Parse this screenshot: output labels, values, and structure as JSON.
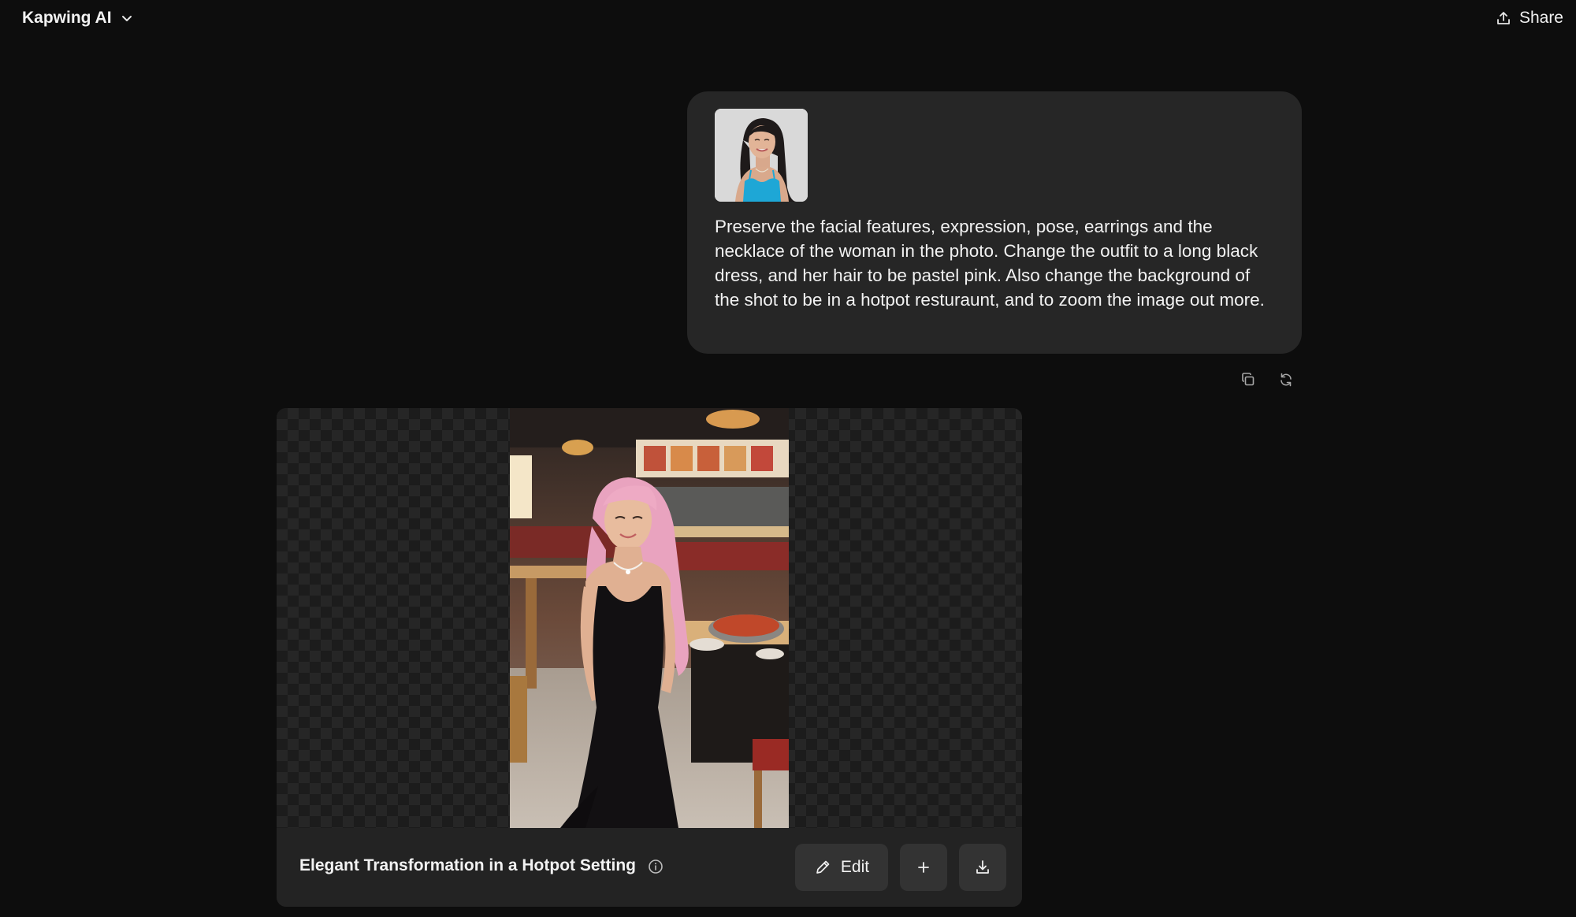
{
  "app": {
    "title": "Kapwing AI",
    "share_label": "Share"
  },
  "user_message": {
    "attachment": "woman in blue top reference photo",
    "prompt": "Preserve the facial features, expression, pose, earrings and the necklace of the woman in the photo. Change the outfit to a long black dress, and her hair to be pastel pink. Also change the background of the shot to be in a hotpot resturaunt, and to zoom the image out more."
  },
  "message_actions": {
    "icons": [
      "copy-icon",
      "regenerate-icon"
    ]
  },
  "result": {
    "title": "Elegant Transformation in a Hotpot Setting",
    "edit_label": "Edit",
    "icons": [
      "info-icon",
      "pencil-icon",
      "plus-icon",
      "download-icon"
    ]
  },
  "colors": {
    "background": "#0d0d0d",
    "bubble": "#262626",
    "button": "#333333",
    "text": "#f2f2f2"
  }
}
